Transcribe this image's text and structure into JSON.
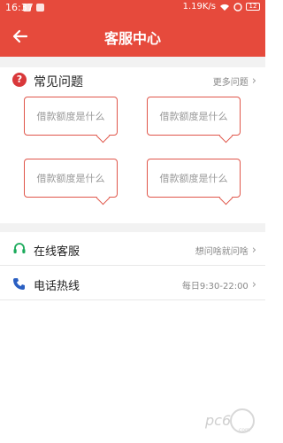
{
  "status_bar": {
    "time": "16:37",
    "network_speed": "1.19",
    "network_unit": "K/s",
    "battery": "12"
  },
  "header": {
    "title": "客服中心"
  },
  "faq": {
    "title": "常见问题",
    "more_label": "更多问题",
    "items": [
      "借款额度是什么",
      "借款额度是什么",
      "借款额度是什么",
      "借款额度是什么"
    ]
  },
  "services": [
    {
      "label": "在线客服",
      "hint": "想问啥就问啥",
      "icon": "headset-icon"
    },
    {
      "label": "电话热线",
      "hint": "每日9:30-22:00",
      "icon": "phone-icon"
    }
  ],
  "watermark": {
    "text": "pc6",
    "sub": "com"
  },
  "colors": {
    "brand_red": "#e64a3c",
    "bubble_border": "#e0564a",
    "online_green": "#1aaa5a",
    "phone_blue": "#2a5fc2"
  }
}
